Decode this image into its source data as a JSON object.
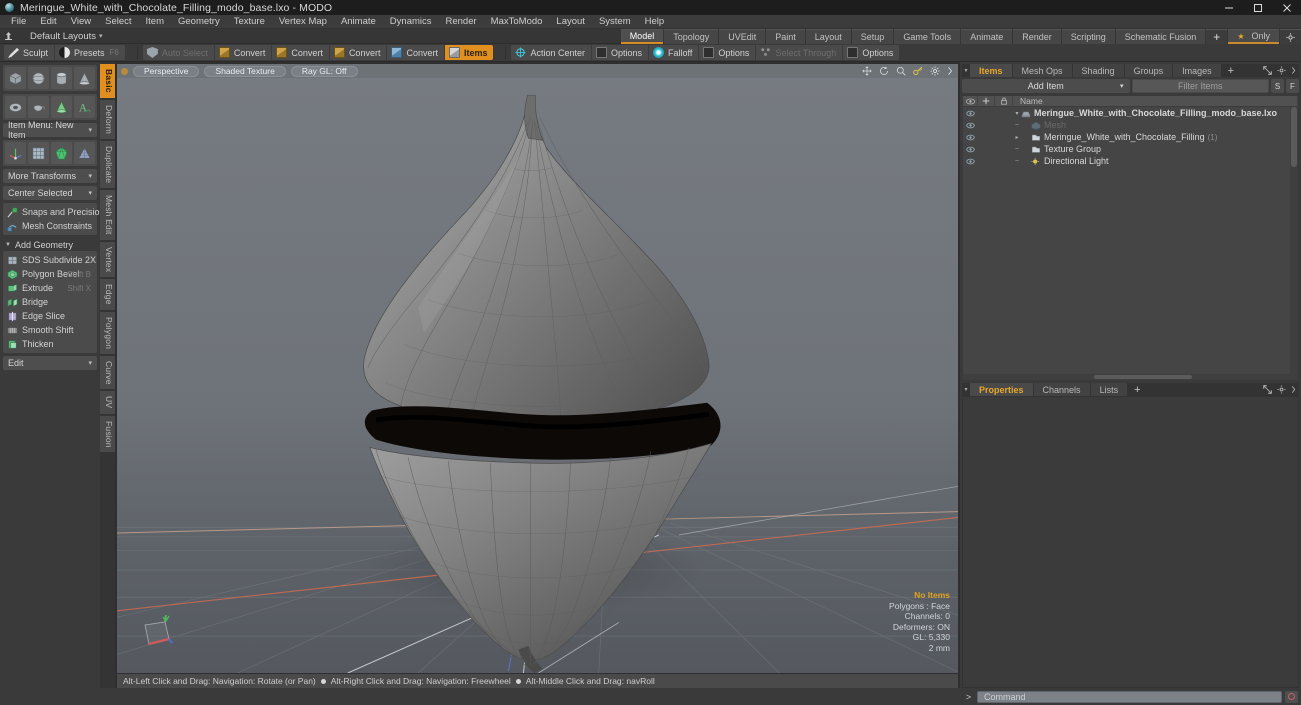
{
  "window": {
    "title": "Meringue_White_with_Chocolate_Filling_modo_base.lxo - MODO",
    "app_icon": "modo-sphere-icon",
    "minimize": "minimize-icon",
    "maximize": "maximize-icon",
    "close": "close-icon"
  },
  "menubar": {
    "items": [
      "File",
      "Edit",
      "View",
      "Select",
      "Item",
      "Geometry",
      "Texture",
      "Vertex Map",
      "Animate",
      "Dynamics",
      "Render",
      "MaxToModo",
      "Layout",
      "System",
      "Help"
    ]
  },
  "layoutbar": {
    "anchor_icon": "anchor-icon",
    "default_layouts": "Default Layouts",
    "caret": "▾",
    "tabs": [
      {
        "label": "Model",
        "active": true
      },
      {
        "label": "Topology",
        "active": false
      },
      {
        "label": "UVEdit",
        "active": false
      },
      {
        "label": "Paint",
        "active": false
      },
      {
        "label": "Layout",
        "active": false
      },
      {
        "label": "Setup",
        "active": false
      },
      {
        "label": "Game Tools",
        "active": false
      },
      {
        "label": "Animate",
        "active": false
      },
      {
        "label": "Render",
        "active": false
      },
      {
        "label": "Scripting",
        "active": false
      },
      {
        "label": "Schematic Fusion",
        "active": false
      }
    ],
    "add_tab": "+",
    "only_label": "Only",
    "gear_icon": "gear-icon"
  },
  "modebar": {
    "sculpt": "Sculpt",
    "presets": "Presets",
    "presets_key": "F6",
    "auto_select": "Auto Select",
    "convert1": "Convert",
    "convert2": "Convert",
    "convert3": "Convert",
    "convert4": "Convert",
    "items": "Items",
    "action_center": "Action Center",
    "options1": "Options",
    "falloff": "Falloff",
    "options2": "Options",
    "select_through": "Select Through",
    "options3": "Options"
  },
  "toolbox": {
    "primitives_row1": [
      "cube-tool",
      "sphere-tool",
      "cylinder-tool",
      "cone-tool"
    ],
    "primitives_row2": [
      "torus-tool",
      "teapot-tool",
      "capsule-tool",
      "text-tool"
    ],
    "item_menu": "Item Menu: New Item",
    "transforms_row": [
      "transform-tool",
      "grid-tool",
      "gem-tool",
      "pyramid-tool"
    ],
    "more_transforms": "More Transforms",
    "center_selected": "Center Selected",
    "snaps": "Snaps and Precision",
    "mesh_constraints": "Mesh Constraints",
    "add_geometry": "Add Geometry",
    "ops": [
      {
        "label": "SDS Subdivide 2X",
        "shortcut": "",
        "icon": "subdivide-icon"
      },
      {
        "label": "Polygon Bevel",
        "shortcut": "Shift B",
        "icon": "bevel-icon"
      },
      {
        "label": "Extrude",
        "shortcut": "Shift X",
        "icon": "extrude-icon"
      },
      {
        "label": "Bridge",
        "shortcut": "",
        "icon": "bridge-icon"
      },
      {
        "label": "Edge Slice",
        "shortcut": "",
        "icon": "edge-slice-icon"
      },
      {
        "label": "Smooth Shift",
        "shortcut": "",
        "icon": "smooth-shift-icon"
      },
      {
        "label": "Thicken",
        "shortcut": "",
        "icon": "thicken-icon"
      }
    ],
    "edit_dropdown": "Edit"
  },
  "vtabs": [
    {
      "label": "Basic",
      "active": true
    },
    {
      "label": "Deform",
      "active": false
    },
    {
      "label": "Duplicate",
      "active": false
    },
    {
      "label": "Mesh Edit",
      "active": false
    },
    {
      "label": "Vertex",
      "active": false
    },
    {
      "label": "Edge",
      "active": false
    },
    {
      "label": "Polygon",
      "active": false
    },
    {
      "label": "Curve",
      "active": false
    },
    {
      "label": "UV",
      "active": false
    },
    {
      "label": "Fusion",
      "active": false
    }
  ],
  "viewport": {
    "perspective": "Perspective",
    "shading": "Shaded Texture",
    "raygl": "Ray GL: Off",
    "icons": [
      "move-view-icon",
      "rotate-view-icon",
      "zoom-view-icon",
      "key-icon",
      "gear-icon",
      "chevron-right-icon"
    ],
    "stats": {
      "selection": "No Items",
      "polygons": "Polygons : Face",
      "channels": "Channels: 0",
      "deformers": "Deformers: ON",
      "gl": "GL: 5,330",
      "scale": "2 mm"
    },
    "status": [
      "Alt-Left Click and Drag: Navigation: Rotate (or Pan)",
      "Alt-Right Click and Drag: Navigation: Freewheel",
      "Alt-Middle Click and Drag: navRoll"
    ],
    "gizmo": "axis-gizmo"
  },
  "rightpanel": {
    "tabs": [
      {
        "label": "Items",
        "active": true
      },
      {
        "label": "Mesh Ops",
        "active": false
      },
      {
        "label": "Shading",
        "active": false
      },
      {
        "label": "Groups",
        "active": false
      },
      {
        "label": "Images",
        "active": false
      }
    ],
    "add_tab": "+",
    "expand_icon": "expand-icon",
    "gear_icon": "gear-icon",
    "chevron_icon": "chevron-right-icon",
    "add_item": "Add Item",
    "add_item_caret": "▾",
    "filter_placeholder": "Filter Items",
    "filter_btn_s": "S",
    "filter_btn_f": "F",
    "columns": {
      "eye": "eye-icon",
      "add": "add-icon",
      "lock": "lock-icon",
      "name": "Name"
    },
    "tree": [
      {
        "label": "Meringue_White_with_Chocolate_Filling_modo_base.lxo",
        "indent": 0,
        "icon": "scene-icon",
        "disclosure": "▾",
        "bold": true,
        "dim": false,
        "count": ""
      },
      {
        "label": "Mesh",
        "indent": 1,
        "icon": "mesh-icon",
        "disclosure": "",
        "bold": false,
        "dim": true,
        "count": ""
      },
      {
        "label": "Meringue_White_with_Chocolate_Filling",
        "indent": 1,
        "icon": "mesh-layer-icon",
        "disclosure": "▸",
        "bold": false,
        "dim": false,
        "count": "(1)"
      },
      {
        "label": "Texture Group",
        "indent": 1,
        "icon": "group-icon",
        "disclosure": "",
        "bold": false,
        "dim": false,
        "count": ""
      },
      {
        "label": "Directional Light",
        "indent": 1,
        "icon": "light-icon",
        "disclosure": "",
        "bold": false,
        "dim": false,
        "count": ""
      }
    ],
    "properties_tabs": [
      {
        "label": "Properties",
        "active": true
      },
      {
        "label": "Channels",
        "active": false
      },
      {
        "label": "Lists",
        "active": false
      }
    ],
    "properties_add": "+"
  },
  "commandbar": {
    "chevron": ">",
    "placeholder": "Command",
    "record_icon": "record-icon"
  }
}
